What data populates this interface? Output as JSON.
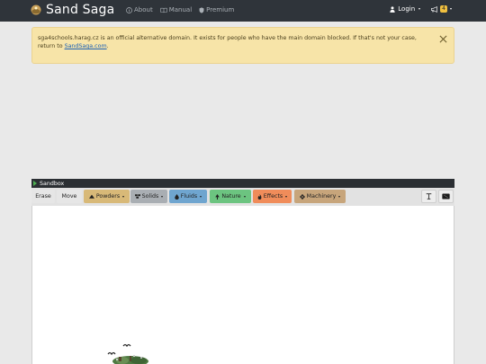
{
  "navbar": {
    "title": "Sand Saga",
    "links": [
      {
        "label": "About",
        "icon": "info-circle-icon"
      },
      {
        "label": "Manual",
        "icon": "book-icon"
      },
      {
        "label": "Premium",
        "icon": "shield-icon"
      }
    ],
    "login_label": "Login",
    "notification_count": "4"
  },
  "alert": {
    "text": "sga4schools.harag.cz is an official alternative domain. It exists for people who have the main domain blocked. If that's not your case, return to ",
    "link_text": "SandSaga.com",
    "text_end": "."
  },
  "sandbox": {
    "title": "Sandbox",
    "tools": [
      {
        "label": "Erase",
        "color": "#e6e6e6"
      },
      {
        "label": "Move",
        "color": "#e6e6e6"
      },
      {
        "label": "Powders",
        "color": "#d8b978",
        "icon": "powder-pile-icon"
      },
      {
        "label": "Solids",
        "color": "#a9aeb3",
        "icon": "bricks-icon"
      },
      {
        "label": "Fluids",
        "color": "#6fa5cf",
        "icon": "droplet-icon"
      },
      {
        "label": "Nature",
        "color": "#6cc480",
        "icon": "tree-icon"
      },
      {
        "label": "Effects",
        "color": "#f08c5a",
        "icon": "fire-icon"
      },
      {
        "label": "Machinery",
        "color": "#c7a57b",
        "icon": "gear-icon"
      }
    ]
  }
}
